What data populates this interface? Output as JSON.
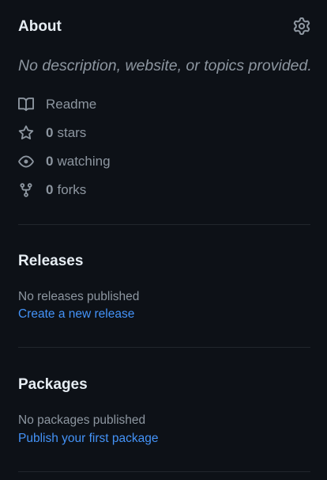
{
  "about": {
    "title": "About",
    "description": "No description, website, or topics provided.",
    "readme_label": "Readme",
    "stars_count": "0",
    "stars_label": "stars",
    "watching_count": "0",
    "watching_label": "watching",
    "forks_count": "0",
    "forks_label": "forks"
  },
  "releases": {
    "title": "Releases",
    "empty_text": "No releases published",
    "create_link": "Create a new release"
  },
  "packages": {
    "title": "Packages",
    "empty_text": "No packages published",
    "publish_link": "Publish your first package"
  },
  "icons": {
    "settings": "gear-icon",
    "readme": "book-icon",
    "stars": "star-icon",
    "watching": "eye-icon",
    "forks": "repo-forked-icon"
  },
  "colors": {
    "background": "#0d1117",
    "text": "#e6edf3",
    "muted": "#8d96a0",
    "link": "#4493f8",
    "divider": "#21262d"
  }
}
